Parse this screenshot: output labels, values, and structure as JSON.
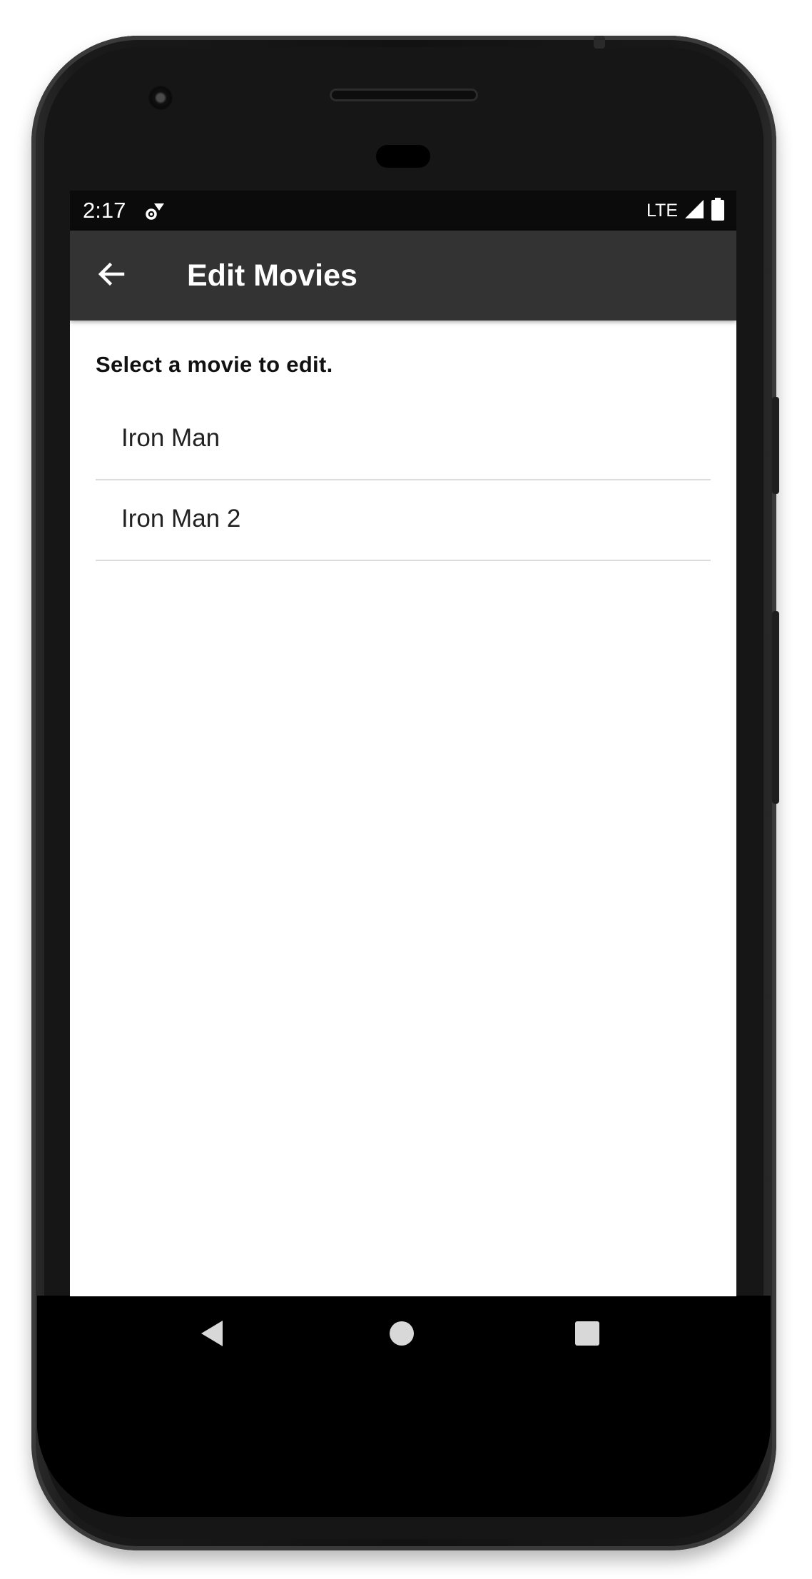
{
  "status_bar": {
    "time": "2:17",
    "network": "LTE",
    "notification_icon": "settings-notification-icon",
    "signal_icon": "signal-icon",
    "battery_icon": "battery-icon"
  },
  "app_bar": {
    "title": "Edit Movies",
    "back_icon": "arrow-left-icon",
    "color": "#333333"
  },
  "main": {
    "prompt": "Select a movie to edit.",
    "movies": [
      {
        "label": "Iron Man"
      },
      {
        "label": "Iron Man 2"
      }
    ]
  },
  "nav_bar": {
    "back_icon": "triangle-back-icon",
    "home_icon": "circle-home-icon",
    "recents_icon": "square-recents-icon"
  }
}
